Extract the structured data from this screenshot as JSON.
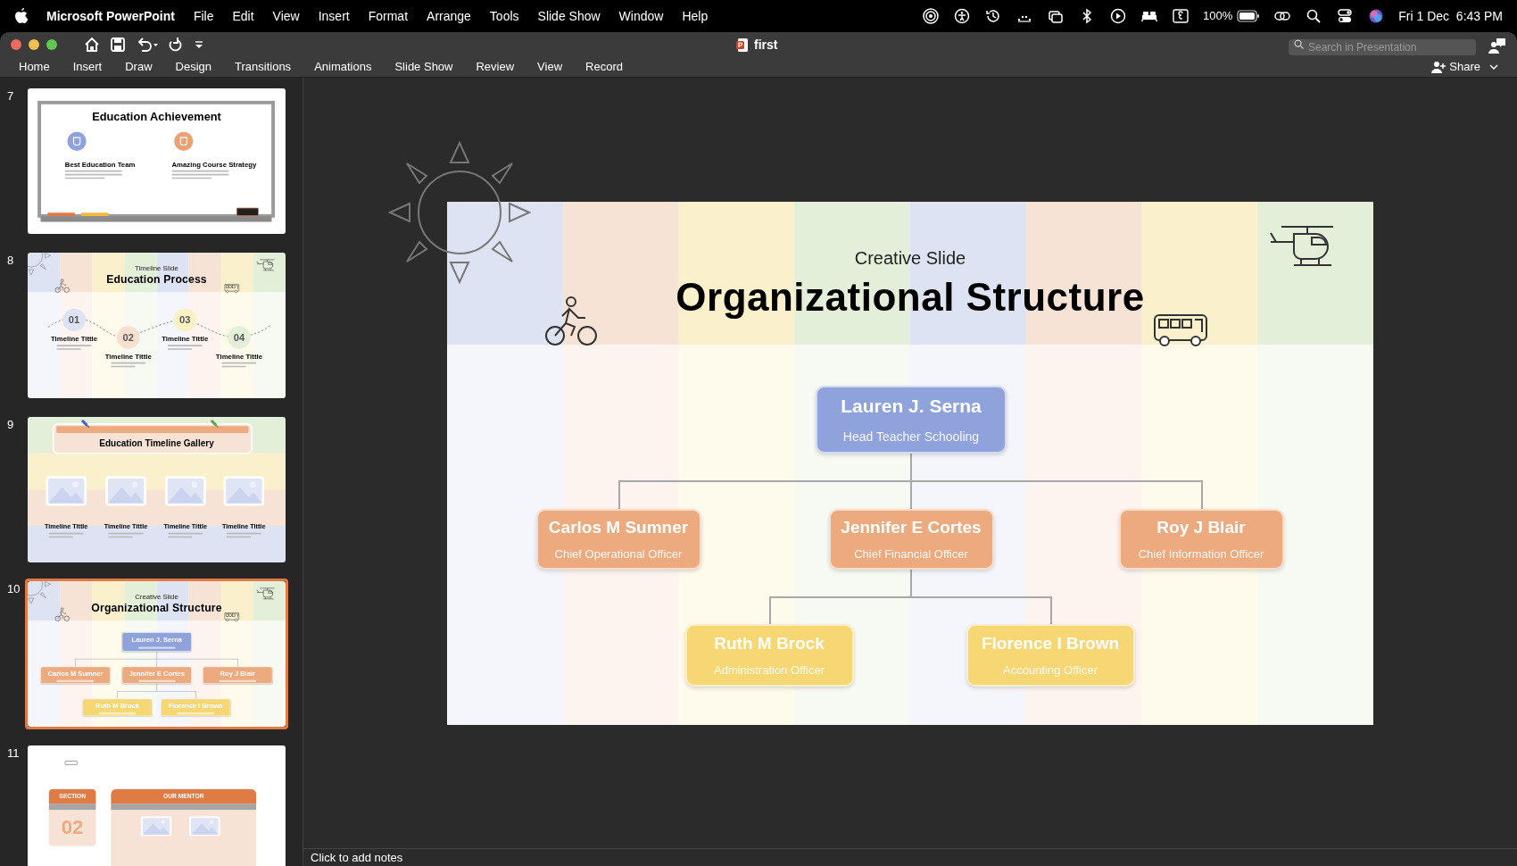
{
  "menu_bar": {
    "app": "Microsoft PowerPoint",
    "menus": [
      "File",
      "Edit",
      "View",
      "Insert",
      "Format",
      "Arrange",
      "Tools",
      "Slide Show",
      "Window",
      "Help"
    ],
    "battery": "100%",
    "clock": "Fri 1 Dec  6:43 PM"
  },
  "window": {
    "title": "first",
    "search": {
      "placeholder": "Search in Presentation"
    },
    "share": "Share"
  },
  "ribbon_tabs": [
    "Home",
    "Insert",
    "Draw",
    "Design",
    "Transitions",
    "Animations",
    "Slide Show",
    "Review",
    "View",
    "Record"
  ],
  "thumbnails": [
    {
      "number": "7",
      "kind": "achievement",
      "selected": false,
      "title": "Education Achievement",
      "items": [
        "Best Education Team",
        "Amazing Course Strategy"
      ]
    },
    {
      "number": "8",
      "kind": "process",
      "selected": false,
      "subtitle": "Timeline Slide",
      "title": "Education Process",
      "steps": [
        {
          "number": "01",
          "label": "Timeline Tittle",
          "color": "#dde3f3"
        },
        {
          "number": "02",
          "label": "Timeline Tittle",
          "color": "#f7e0d0"
        },
        {
          "number": "03",
          "label": "Timeline Tittle",
          "color": "#fbf0c4"
        },
        {
          "number": "04",
          "label": "Timeline Tittle",
          "color": "#e3efd9"
        }
      ]
    },
    {
      "number": "9",
      "kind": "gallery",
      "selected": false,
      "title": "Education Timeline Gallery",
      "items": [
        "Timeline Tittle",
        "Timeline Tittle",
        "Timeline Tittle",
        "Timeline Tittle"
      ]
    },
    {
      "number": "10",
      "kind": "org",
      "selected": true,
      "subtitle": "Creative Slide",
      "title": "Organizational Structure",
      "org": {
        "head": {
          "name": "Lauren J. Serna",
          "color": "#8fa2dc"
        },
        "officers": [
          {
            "name": "Carlos M Sumner",
            "color": "#eeaa7f"
          },
          {
            "name": "Jennifer E Cortes",
            "color": "#eeaa7f"
          },
          {
            "name": "Roy J Blair",
            "color": "#eeaa7f"
          }
        ],
        "staff": [
          {
            "name": "Ruth M Brock",
            "color": "#f7d774"
          },
          {
            "name": "Florence I Brown",
            "color": "#f7d774"
          }
        ]
      }
    },
    {
      "number": "11",
      "kind": "mentor",
      "selected": false,
      "section": "SECTION",
      "section_number": "02",
      "title": "OUR MENTOR"
    }
  ],
  "slide": {
    "subtitle": "Creative Slide",
    "title": "Organizational Structure",
    "org": {
      "head": {
        "name": "Lauren J. Serna",
        "role": "Head Teacher Schooling",
        "color": "#8fa2dc"
      },
      "officers": [
        {
          "name": "Carlos M Sumner",
          "role": "Chief Operational Officer",
          "color": "#eeaa7f"
        },
        {
          "name": "Jennifer E Cortes",
          "role": "Chief Financial Officer",
          "color": "#eeaa7f"
        },
        {
          "name": "Roy J Blair",
          "role": "Chief Information Officer",
          "color": "#eeaa7f"
        }
      ],
      "staff": [
        {
          "name": "Ruth M Brock",
          "role": "Administration Officer",
          "color": "#f7d774"
        },
        {
          "name": "Florence I Brown",
          "role": "Accounting Officer",
          "color": "#f7d774"
        }
      ]
    }
  },
  "notes": {
    "placeholder": "Click to add notes"
  }
}
